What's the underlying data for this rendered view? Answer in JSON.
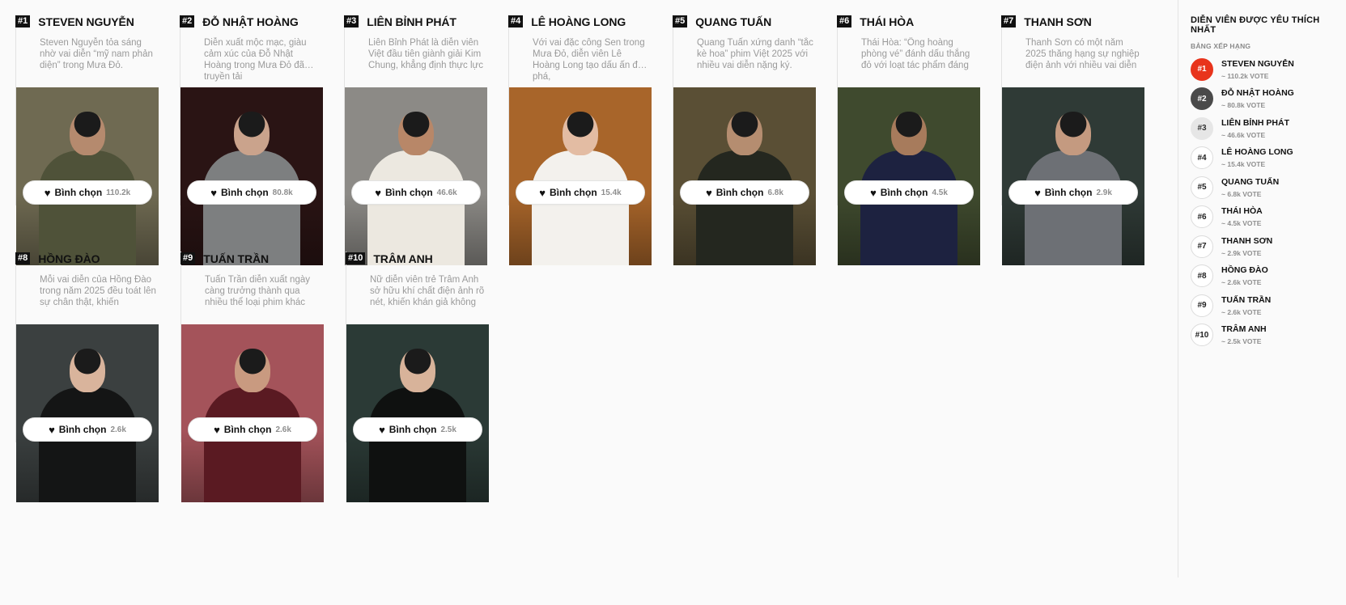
{
  "vote_label": "Bình chọn",
  "vote_icon": "heart-icon",
  "actors": [
    {
      "rank": "#1",
      "name": "STEVEN NGUYỄN",
      "desc": "Steven Nguyễn tỏa sáng nhờ vai diễn “mỹ nam phản diện” trong Mưa Đỏ.",
      "votes": "110.2k",
      "bg": "#6f6a52",
      "skin": "#b58a6e",
      "cloth": "#4f5239"
    },
    {
      "rank": "#2",
      "name": "ĐỖ NHẬT HOÀNG",
      "desc": "Diễn xuất mộc mạc, giàu cảm xúc của Đỗ Nhật Hoàng trong Mưa Đỏ đã truyền tải",
      "votes": "80.8k",
      "bg": "#2a1414",
      "skin": "#caa38c",
      "cloth": "#7d7f80"
    },
    {
      "rank": "#3",
      "name": "LIÊN BỈNH PHÁT",
      "desc": "Liên Bỉnh Phát là diễn viên Việt đầu tiên giành giải Kim Chung, khẳng định thực lực",
      "votes": "46.6k",
      "bg": "#8c8a86",
      "skin": "#b88768",
      "cloth": "#ece8e0"
    },
    {
      "rank": "#4",
      "name": "LÊ HOÀNG LONG",
      "desc": "Với vai đặc công Sen trong Mưa Đỏ, diễn viên Lê Hoàng Long tạo dấu ấn đột phá,",
      "votes": "15.4k",
      "bg": "#a8652a",
      "skin": "#e3bca3",
      "cloth": "#f3f1ed"
    },
    {
      "rank": "#5",
      "name": "QUANG TUẤN",
      "desc": "Quang Tuấn xứng danh “tắc kè hoa” phim Việt 2025 với nhiều vai diễn nặng ký.",
      "votes": "6.8k",
      "bg": "#5a4f35",
      "skin": "#b58d70",
      "cloth": "#24271f"
    },
    {
      "rank": "#6",
      "name": "THÁI HÒA",
      "desc": "Thái Hòa: “Ông hoàng phòng vé” đánh dấu thắng đỏ với loạt tác phẩm đáng",
      "votes": "4.5k",
      "bg": "#3f4a2e",
      "skin": "#a77b5c",
      "cloth": "#1d2240"
    },
    {
      "rank": "#7",
      "name": "THANH SƠN",
      "desc": "Thanh Sơn có một năm 2025 thăng hạng sự nghiệp điện ảnh với nhiều vai diễn",
      "votes": "2.9k",
      "bg": "#2f3a36",
      "skin": "#c49a80",
      "cloth": "#6d7075"
    },
    {
      "rank": "#8",
      "name": "HỒNG ĐÀO",
      "desc": "Mỗi vai diễn của Hồng Đào trong năm 2025 đều toát lên sự chân thật, khiến",
      "votes": "2.6k",
      "bg": "#3b4040",
      "skin": "#d9b49c",
      "cloth": "#141515"
    },
    {
      "rank": "#9",
      "name": "TUẤN TRẦN",
      "desc": "Tuấn Trần diễn xuất ngày càng trưởng thành qua nhiều thể loại phim khác",
      "votes": "2.6k",
      "bg": "#a4535a",
      "skin": "#c99a80",
      "cloth": "#5a1a22"
    },
    {
      "rank": "#10",
      "name": "TRÂM ANH",
      "desc": "Nữ diễn viên trẻ Trâm Anh sở hữu khí chất điện ảnh rõ nét, khiến khán giả không",
      "votes": "2.5k",
      "bg": "#2b3a36",
      "skin": "#d8b39a",
      "cloth": "#0f1110"
    }
  ],
  "sidebar": {
    "title": "DIỄN VIÊN ĐƯỢC YÊU THÍCH NHẤT",
    "subtitle": "BẢNG XẾP HẠNG",
    "vote_prefix": "~",
    "vote_suffix": "VOTE",
    "accent_first": "#e8341c",
    "second_color": "#4a4a4a",
    "third_color": "#e6e6e6"
  }
}
